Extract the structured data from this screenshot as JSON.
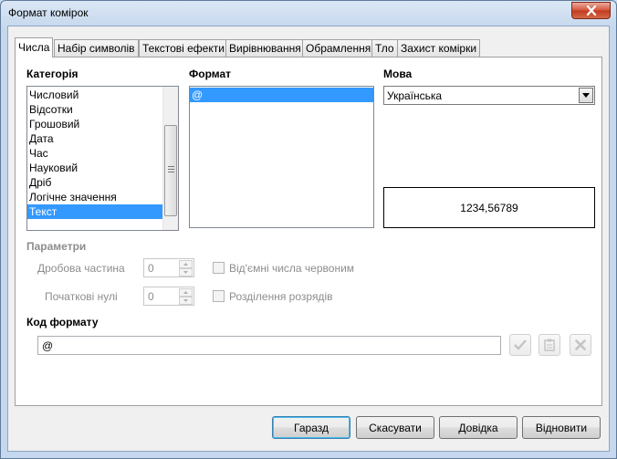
{
  "window": {
    "title": "Формат комірок"
  },
  "tabs": [
    {
      "label": "Числа",
      "active": true
    },
    {
      "label": "Набір символів",
      "active": false
    },
    {
      "label": "Текстові ефекти",
      "active": false
    },
    {
      "label": "Вирівнювання",
      "active": false
    },
    {
      "label": "Обрамлення",
      "active": false
    },
    {
      "label": "Тло",
      "active": false
    },
    {
      "label": "Захист комірки",
      "active": false
    }
  ],
  "category": {
    "label": "Категорія",
    "items": [
      "Числовий",
      "Відсотки",
      "Грошовий",
      "Дата",
      "Час",
      "Науковий",
      "Дріб",
      "Логічне значення",
      "Текст"
    ],
    "selected": "Текст"
  },
  "format": {
    "label": "Формат",
    "items": [
      "@"
    ],
    "selected": "@"
  },
  "language": {
    "label": "Мова",
    "value": "Українська"
  },
  "preview": {
    "value": "1234,56789"
  },
  "parameters": {
    "label": "Параметри",
    "decimal_label": "Дробова частина",
    "decimal_value": "0",
    "leading_zeros_label": "Початкові нулі",
    "leading_zeros_value": "0",
    "negative_red_label": "Від'ємні числа червоним",
    "negative_red_checked": false,
    "thousands_sep_label": "Розділення розрядів",
    "thousands_sep_checked": false
  },
  "format_code": {
    "label": "Код формату",
    "value": "@"
  },
  "buttons": {
    "ok": "Гаразд",
    "cancel": "Скасувати",
    "help": "Довідка",
    "reset": "Відновити"
  },
  "colors": {
    "selection": "#3399ff",
    "disabled_text": "#8d8d8d",
    "title_bar": "#c6d8ee"
  }
}
